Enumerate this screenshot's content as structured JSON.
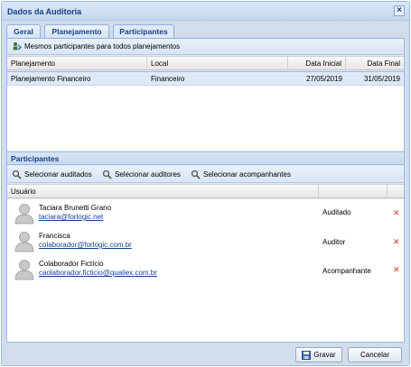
{
  "window": {
    "title": "Dados da Auditoria"
  },
  "tabs": [
    {
      "label": "Geral"
    },
    {
      "label": "Planejamento"
    },
    {
      "label": "Participantes"
    }
  ],
  "planning": {
    "toolbar_label": "Mesmos participantes para todos planejamentos",
    "columns": [
      "Planejamento",
      "Local",
      "Data Inicial",
      "Data Final"
    ],
    "rows": [
      {
        "plan": "Planejamento Financeiro",
        "local": "Financeiro",
        "start": "27/05/2019",
        "end": "31/05/2019"
      }
    ]
  },
  "participants": {
    "section_title": "Participantes",
    "toolbar": {
      "select_audited": "Selecionar auditados",
      "select_auditors": "Selecionar auditores",
      "select_companions": "Selecionar acompanhantes"
    },
    "column_user": "Usuário",
    "rows": [
      {
        "name": "Taciara Brunetti Grano",
        "email": "taciara@forlogic.net",
        "role": "Auditado"
      },
      {
        "name": "Francisca",
        "email": "colaborador@forlogic.com.br",
        "role": "Auditor"
      },
      {
        "name": "Colaborador Fictício",
        "email": "caolaborador.ficticio@qualiex.com.br",
        "role": "Acompanhante"
      }
    ]
  },
  "footer": {
    "save": "Gravar",
    "cancel": "Cancelar"
  },
  "colors": {
    "accent": "#15428b",
    "border": "#99bbe8",
    "delete": "#dd3333"
  }
}
